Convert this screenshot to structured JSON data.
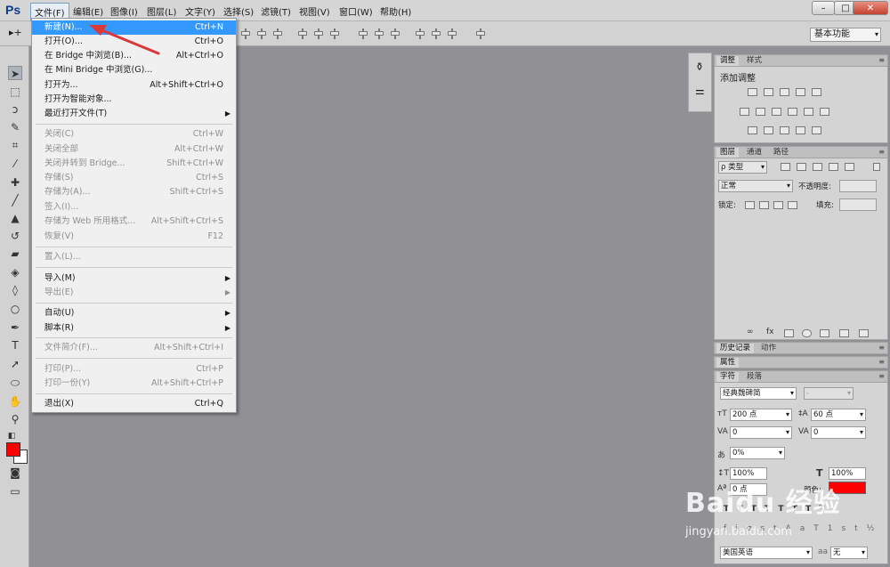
{
  "app": {
    "logo": "Ps"
  },
  "menubar": {
    "items": [
      "文件(F)",
      "编辑(E)",
      "图像(I)",
      "图层(L)",
      "文字(Y)",
      "选择(S)",
      "滤镜(T)",
      "视图(V)",
      "窗口(W)",
      "帮助(H)"
    ],
    "window_buttons": {
      "minimize": "–",
      "restore": "□",
      "close": "✕"
    }
  },
  "options": {
    "workspace": "基本功能"
  },
  "file_menu": {
    "items": [
      {
        "label": "新建(N)...",
        "shortcut": "Ctrl+N",
        "highlighted": true
      },
      {
        "label": "打开(O)...",
        "shortcut": "Ctrl+O"
      },
      {
        "label": "在 Bridge 中浏览(B)...",
        "shortcut": "Alt+Ctrl+O"
      },
      {
        "label": "在 Mini Bridge 中浏览(G)...",
        "shortcut": ""
      },
      {
        "label": "打开为...",
        "shortcut": "Alt+Shift+Ctrl+O"
      },
      {
        "label": "打开为智能对象...",
        "shortcut": ""
      },
      {
        "label": "最近打开文件(T)",
        "shortcut": "",
        "submenu": true
      },
      {
        "label": "关闭(C)",
        "shortcut": "Ctrl+W",
        "disabled": true
      },
      {
        "label": "关闭全部",
        "shortcut": "Alt+Ctrl+W",
        "disabled": true
      },
      {
        "label": "关闭并转到 Bridge...",
        "shortcut": "Shift+Ctrl+W",
        "disabled": true
      },
      {
        "label": "存储(S)",
        "shortcut": "Ctrl+S",
        "disabled": true
      },
      {
        "label": "存储为(A)...",
        "shortcut": "Shift+Ctrl+S",
        "disabled": true
      },
      {
        "label": "签入(I)...",
        "shortcut": "",
        "disabled": true
      },
      {
        "label": "存储为 Web 所用格式...",
        "shortcut": "Alt+Shift+Ctrl+S",
        "disabled": true
      },
      {
        "label": "恢复(V)",
        "shortcut": "F12",
        "disabled": true
      },
      {
        "label": "置入(L)...",
        "shortcut": "",
        "disabled": true
      },
      {
        "label": "导入(M)",
        "shortcut": "",
        "submenu": true
      },
      {
        "label": "导出(E)",
        "shortcut": "",
        "submenu": true,
        "disabled": true
      },
      {
        "label": "自动(U)",
        "shortcut": "",
        "submenu": true
      },
      {
        "label": "脚本(R)",
        "shortcut": "",
        "submenu": true
      },
      {
        "label": "文件简介(F)...",
        "shortcut": "Alt+Shift+Ctrl+I",
        "disabled": true
      },
      {
        "label": "打印(P)...",
        "shortcut": "Ctrl+P",
        "disabled": true
      },
      {
        "label": "打印一份(Y)",
        "shortcut": "Alt+Shift+Ctrl+P",
        "disabled": true
      },
      {
        "label": "退出(X)",
        "shortcut": "Ctrl+Q"
      }
    ]
  },
  "panels": {
    "adjust": {
      "tabs": [
        "调整",
        "样式"
      ],
      "title": "添加调整"
    },
    "layers": {
      "tabs": [
        "图层",
        "通道",
        "路径"
      ],
      "filter": "ρ 类型",
      "blend": "正常",
      "opacity_label": "不透明度:",
      "lock_label": "锁定:",
      "fill_label": "填充:"
    },
    "history": {
      "tabs": [
        "历史记录",
        "动作"
      ]
    },
    "properties": {
      "tabs": [
        "属性"
      ]
    },
    "character": {
      "tabs": [
        "字符",
        "段落"
      ],
      "font_family": "经典魏碑简",
      "font_style": "-",
      "size": "200 点",
      "leading": "60 点",
      "kerning": "0",
      "tracking": "0",
      "scale_pct": "0%",
      "vscale": "100%",
      "hscale": "100%",
      "baseline": "0 点",
      "color_label": "颜色:",
      "color": "#ff0000",
      "language": "美国英语",
      "antialias": "无",
      "aa_icon": "aa"
    }
  },
  "colors": {
    "foreground": "#ff0000",
    "background": "#ffffff"
  },
  "watermark": {
    "text": "Baidu 经验",
    "url": "jingyan.baidu.com"
  }
}
